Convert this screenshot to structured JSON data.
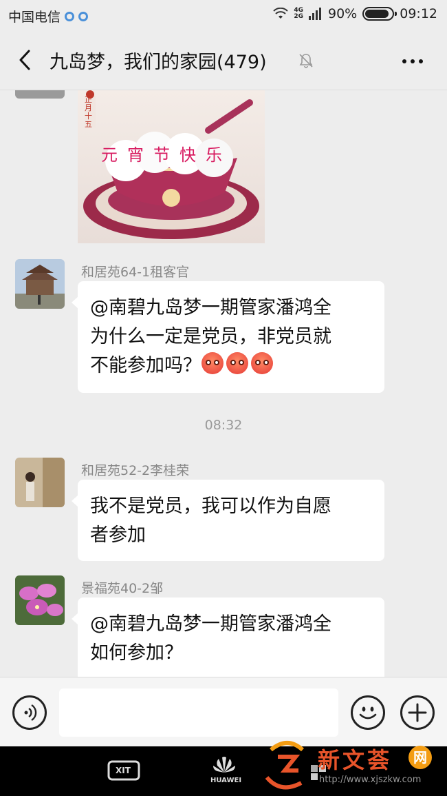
{
  "status_bar": {
    "carrier": "中国电信",
    "network": "4G",
    "network2": "2G",
    "battery": "90%",
    "battery_level": 0.9,
    "time": "09:12"
  },
  "header": {
    "title": "九岛梦，我们的家园(479)"
  },
  "messages": [
    {
      "sender": "和居苑64-1租客官",
      "text_lines": [
        "@南碧九岛梦一期管家潘鸿全",
        "为什么一定是党员，非党员就",
        "不能参加吗？"
      ]
    },
    {
      "sender": "和居苑52-2李桂荣",
      "text_lines": [
        "我不是党员，我可以作为自愿",
        "者参加"
      ]
    },
    {
      "sender": "景福苑40-2邹",
      "text_lines": [
        "@南碧九岛梦一期管家潘鸿全",
        "如何参加？"
      ]
    }
  ],
  "sticker": {
    "caption": "元宵节快乐",
    "tag": "正月十五"
  },
  "timestamp": "08:32",
  "input": {
    "placeholder": ""
  },
  "nav": {
    "exit_label": "XIT",
    "brand_label": "HUAWEI"
  },
  "watermark": {
    "name": "新文荟",
    "badge": "网",
    "url": "http://www.xjszkw.com"
  },
  "colors": {
    "background": "#ededed",
    "bubble": "#ffffff",
    "meta_text": "#888888",
    "watermark_orange": "#e8542a"
  }
}
